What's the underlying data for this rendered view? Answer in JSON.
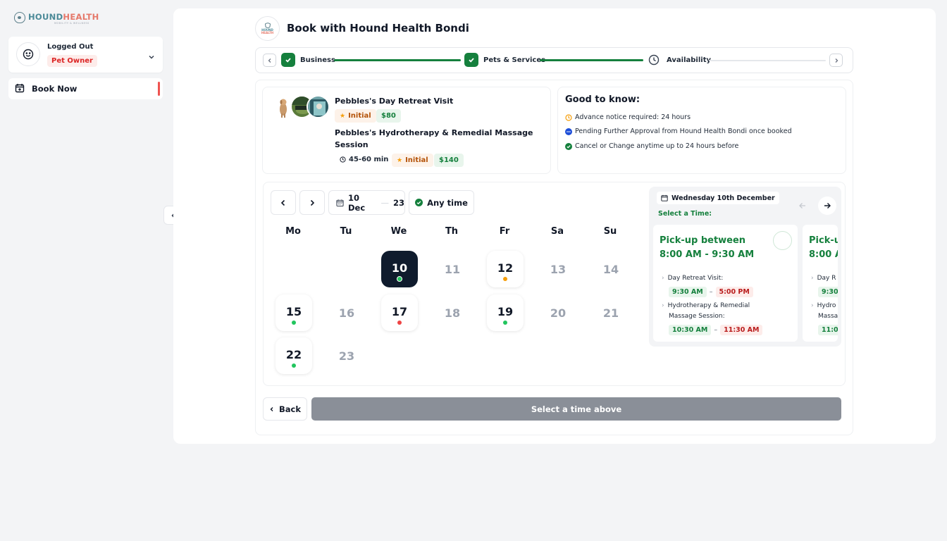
{
  "sidebar": {
    "logo": {
      "part1": "HOUND",
      "part2": "HEALTH",
      "tagline": "MOBILITY & WELLNESS"
    },
    "user": {
      "status": "Logged Out",
      "role": "Pet Owner"
    },
    "nav": [
      {
        "label": "Book Now",
        "icon": "calendar-plus-icon"
      }
    ]
  },
  "header": {
    "title": "Book with Hound Health Bondi",
    "logo_line1": "HOUND",
    "logo_line2": "HEALTH"
  },
  "stepper": {
    "steps": [
      {
        "label": "Business",
        "state": "complete"
      },
      {
        "label": "Pets & Services",
        "state": "complete"
      },
      {
        "label": "Availability",
        "state": "current"
      }
    ]
  },
  "services": [
    {
      "title": "Pebbles's Day Retreat Visit",
      "badge": "Initial",
      "price": "$80"
    },
    {
      "title": "Pebbles's Hydrotherapy & Remedial Massage Session",
      "duration": "45-60 min",
      "badge": "Initial",
      "price": "$140"
    }
  ],
  "good_to_know": {
    "title": "Good to know:",
    "items": [
      {
        "text": "Advance notice required: 24 hours",
        "icon": "clock-icon"
      },
      {
        "text": "Pending Further Approval from Hound Health Bondi once booked",
        "icon": "pending-icon"
      },
      {
        "text": "Cancel or Change anytime up to 24 hours before",
        "icon": "check-circle-icon"
      }
    ]
  },
  "calendar": {
    "range_start": "10 Dec",
    "range_end": "23",
    "filter": "Any time",
    "weekdays": [
      "Mo",
      "Tu",
      "We",
      "Th",
      "Fr",
      "Sa",
      "Su"
    ],
    "days": [
      {
        "n": "10",
        "state": "selected",
        "dot": "#22c55e"
      },
      {
        "n": "11",
        "state": "disabled"
      },
      {
        "n": "12",
        "state": "available",
        "dot": "#f59e0b"
      },
      {
        "n": "13",
        "state": "disabled"
      },
      {
        "n": "14",
        "state": "disabled"
      },
      {
        "n": "15",
        "state": "available",
        "dot": "#22c55e"
      },
      {
        "n": "16",
        "state": "disabled"
      },
      {
        "n": "17",
        "state": "available",
        "dot": "#ef4444"
      },
      {
        "n": "18",
        "state": "disabled"
      },
      {
        "n": "19",
        "state": "available",
        "dot": "#22c55e"
      },
      {
        "n": "20",
        "state": "disabled"
      },
      {
        "n": "21",
        "state": "disabled"
      },
      {
        "n": "22",
        "state": "available",
        "dot": "#22c55e"
      },
      {
        "n": "23",
        "state": "disabled"
      }
    ]
  },
  "times": {
    "date": "Wednesday 10th December",
    "prompt": "Select a Time:",
    "slots": [
      {
        "title_line1": "Pick-up between",
        "title_line2": "8:00 AM - 9:30 AM",
        "svc1": "Day Retreat Visit:",
        "svc1_start": "9:30 AM",
        "svc1_end": "5:00 PM",
        "svc2_line1": "Hydrotherapy & Remedial",
        "svc2_line2": "Massage Session:",
        "svc2_start": "10:30 AM",
        "svc2_end": "11:30 AM"
      },
      {
        "title_line1": "Pick-u",
        "title_line2": "8:00 A",
        "svc1": "Day R",
        "svc1_start": "9:30",
        "svc2_line1": "Hydro",
        "svc2_line2": "Massa",
        "svc2_start": "11:0"
      }
    ]
  },
  "footer": {
    "back": "Back",
    "submit": "Select a time above"
  },
  "colors": {
    "accent_green": "#15803d",
    "red_accent": "#ef5350",
    "disabled_button": "#8a8f98",
    "selected_day": "#0f1b2d"
  }
}
